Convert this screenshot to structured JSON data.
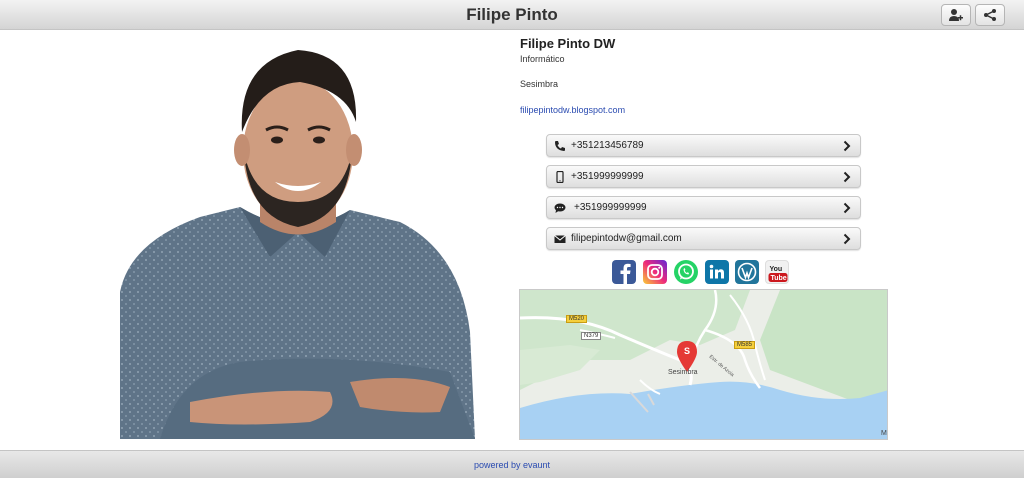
{
  "header": {
    "title": "Filipe Pinto"
  },
  "profile": {
    "name": "Filipe Pinto DW",
    "job": "Informático",
    "city": "Sesimbra",
    "website": "filipepintodw.blogspot.com"
  },
  "contacts": [
    {
      "icon": "phone-icon",
      "value": "+351213456789"
    },
    {
      "icon": "mobile-icon",
      "value": "+351999999999"
    },
    {
      "icon": "chat-icon",
      "value": "+351999999999"
    },
    {
      "icon": "mail-icon",
      "value": "filipepintodw@gmail.com"
    }
  ],
  "social": [
    {
      "name": "facebook-icon",
      "color": "#3b5998"
    },
    {
      "name": "instagram-icon",
      "color": "#c13584"
    },
    {
      "name": "whatsapp-icon",
      "color": "#25d366"
    },
    {
      "name": "linkedin-icon",
      "color": "#0e76a8"
    },
    {
      "name": "wordpress-icon",
      "color": "#21759b"
    },
    {
      "name": "youtube-icon",
      "color": "#cc181e"
    }
  ],
  "map": {
    "roads": [
      "M520",
      "N379",
      "M585"
    ],
    "road_diag": "Estr. de Azoia",
    "place": "Sesimbra",
    "pin_letter": "S",
    "corner": "M"
  },
  "footer": {
    "powered": "powered by evaunt"
  }
}
